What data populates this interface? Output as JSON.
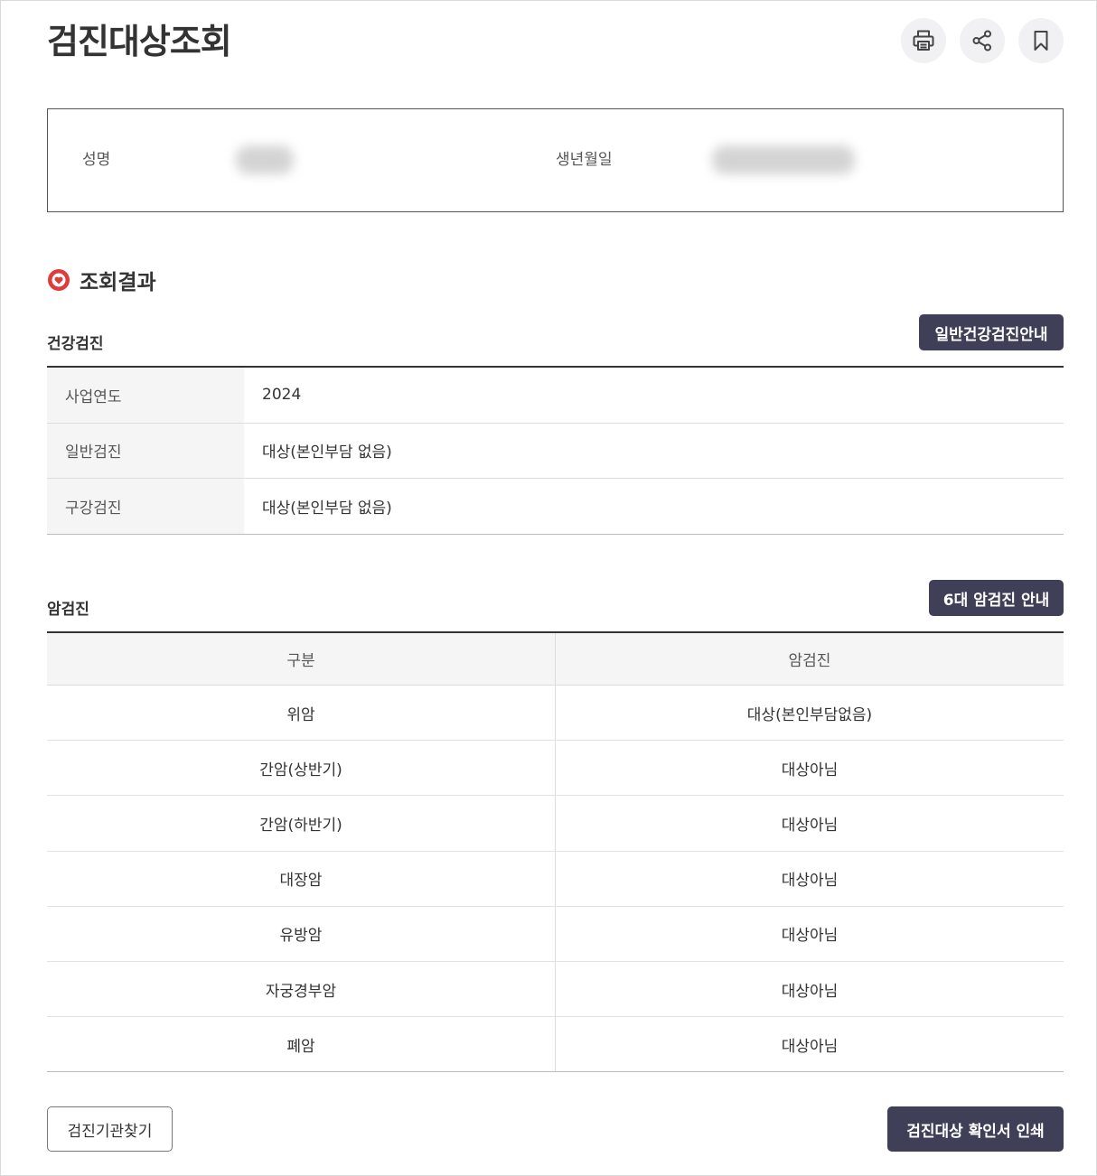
{
  "header": {
    "title": "검진대상조회",
    "actions": [
      {
        "icon": "print-icon",
        "name": "print-button"
      },
      {
        "icon": "share-icon",
        "name": "share-button"
      },
      {
        "icon": "bookmark-icon",
        "name": "bookmark-button"
      }
    ]
  },
  "profile": {
    "name_label": "성명",
    "birth_label": "생년월일"
  },
  "result": {
    "title": "조회결과",
    "icon": "heart-icon"
  },
  "health_checkup": {
    "heading": "건강검진",
    "guide_button": "일반건강검진안내",
    "rows": [
      {
        "label": "사업연도",
        "value": "2024"
      },
      {
        "label": "일반검진",
        "value": "대상(본인부담 없음)"
      },
      {
        "label": "구강검진",
        "value": "대상(본인부담 없음)"
      }
    ]
  },
  "cancer_checkup": {
    "heading": "암검진",
    "guide_button": "6대 암검진 안내",
    "columns": [
      "구분",
      "암검진"
    ],
    "rows": [
      [
        "위암",
        "대상(본인부담없음)"
      ],
      [
        "간암(상반기)",
        "대상아님"
      ],
      [
        "간암(하반기)",
        "대상아님"
      ],
      [
        "대장암",
        "대상아님"
      ],
      [
        "유방암",
        "대상아님"
      ],
      [
        "자궁경부암",
        "대상아님"
      ],
      [
        "폐암",
        "대상아님"
      ]
    ]
  },
  "footer": {
    "find_button": "검진기관찾기",
    "print_button": "검진대상 확인서 인쇄"
  },
  "colors": {
    "dark_button": "#3f3f57",
    "accent_red": "#e03a3a"
  }
}
